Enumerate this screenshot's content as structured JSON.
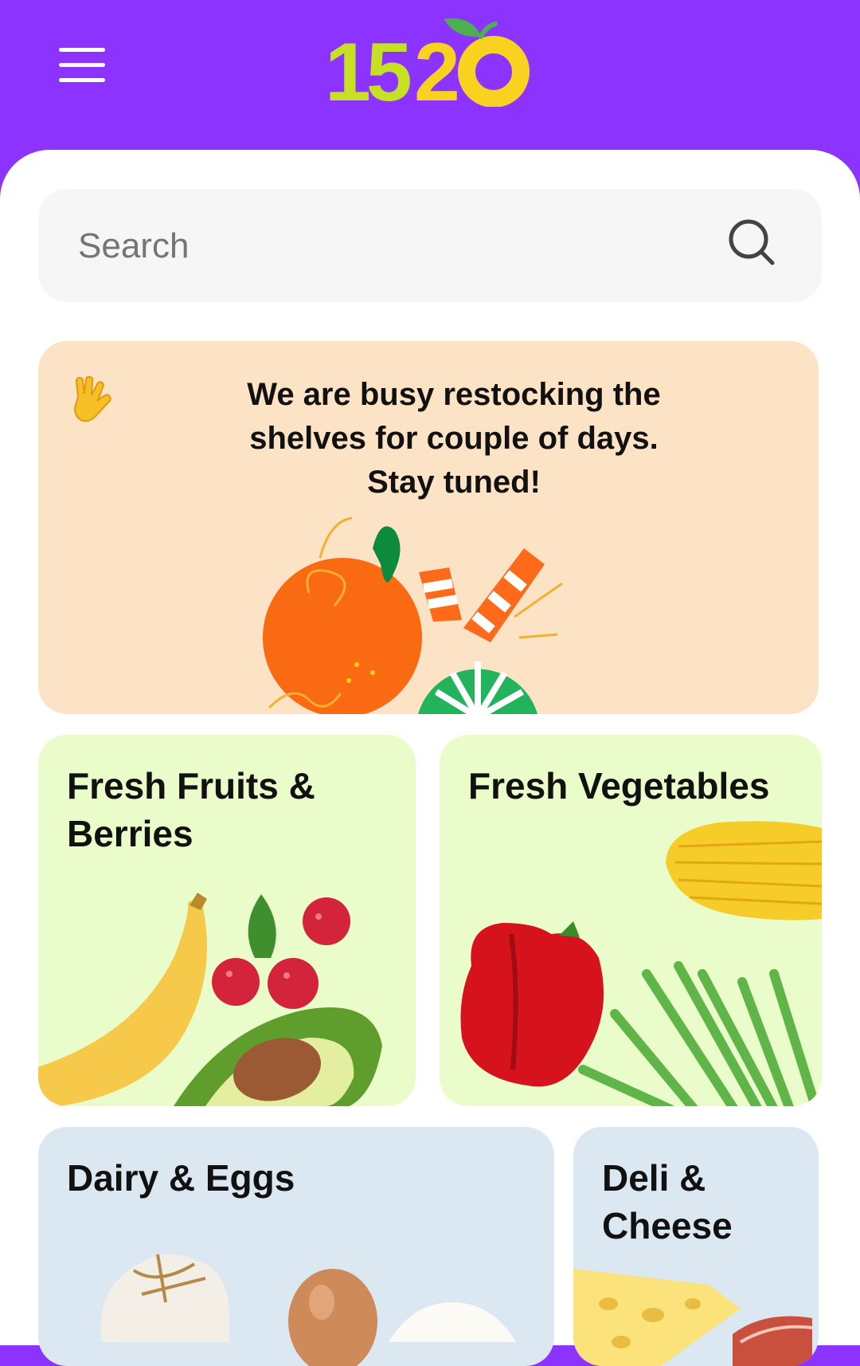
{
  "header": {
    "logo_text": "1520",
    "background": "#8c33ff",
    "logo_colors": [
      "#c6e023",
      "#f8d21f",
      "#4cb050"
    ]
  },
  "search": {
    "placeholder": "Search",
    "icon": "search-icon"
  },
  "banner": {
    "icon": "vulcan-salute-icon",
    "message_lines": [
      "We are busy restocking the",
      "shelves for couple of days.",
      "Stay tuned!"
    ],
    "background": "#fde3c5"
  },
  "categories": [
    {
      "title_lines": [
        "Fresh Fruits &",
        "Berries"
      ],
      "image": "fruits-berries-image",
      "background": "#eafcca"
    },
    {
      "title_lines": [
        "Fresh Vegetables"
      ],
      "image": "vegetables-image",
      "background": "#eafcca"
    },
    {
      "title_lines": [
        "Dairy & Eggs"
      ],
      "image": "dairy-eggs-image",
      "background": "#dce8f1"
    },
    {
      "title_lines": [
        "Deli &",
        "Cheese"
      ],
      "image": "deli-cheese-image",
      "background": "#dce8f1"
    }
  ]
}
